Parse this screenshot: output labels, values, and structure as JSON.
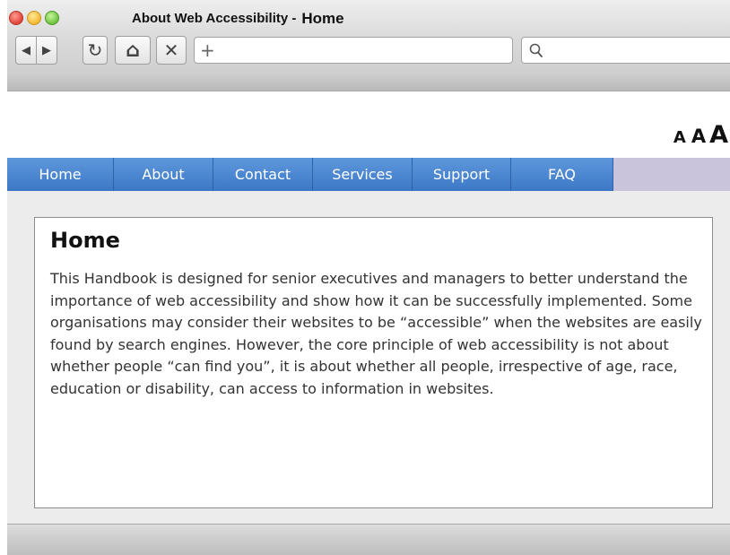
{
  "window": {
    "title": "About Web Accessibility -",
    "tab_title": "Home"
  },
  "toolbar": {
    "back_glyph": "◀",
    "forward_glyph": "▶",
    "reload_glyph": "↻",
    "home_glyph": "⌂",
    "stop_glyph": "✕",
    "new_tab_glyph": "+",
    "address_value": "",
    "search_value": ""
  },
  "text_size": {
    "small": "A",
    "medium": "A",
    "large": "A"
  },
  "nav": {
    "items": [
      {
        "label": "Home"
      },
      {
        "label": "About"
      },
      {
        "label": "Contact"
      },
      {
        "label": "Services"
      },
      {
        "label": "Support"
      },
      {
        "label": "FAQ"
      }
    ]
  },
  "main": {
    "heading": "Home",
    "body": "This Handbook is designed for senior executives and managers to better understand the importance of web accessibility and show how it can be successfully implemented. Some organisations may consider their websites to be “accessible” when the websites are easily found by search engines. However, the core principle of web accessibility is not about whether people “can find you”, it is about whether all people, irrespective of age, race, education or disability, can access to information in websites."
  },
  "colors": {
    "nav_blue": "#4a86d1",
    "nav_filler": "#c9c3dc"
  }
}
